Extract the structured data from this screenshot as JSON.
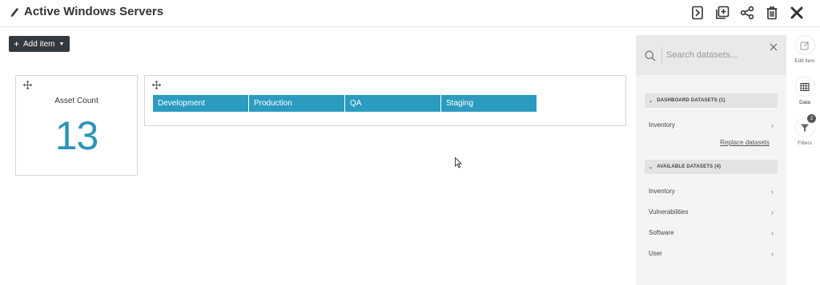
{
  "header": {
    "title": "Active Windows Servers",
    "toolbar": [
      "bookmark-icon",
      "duplicate-icon",
      "share-icon",
      "trash-icon",
      "close-icon"
    ]
  },
  "add_item": {
    "label": "Add item"
  },
  "widgets": {
    "asset_count": {
      "label": "Asset Count",
      "value": "13"
    },
    "tabs": [
      "Development",
      "Production",
      "QA",
      "Staging"
    ]
  },
  "panel": {
    "search_placeholder": "Search datasets...",
    "dashboard_header": "DASHBOARD DATASETS (1)",
    "dashboard_items": [
      "Inventory"
    ],
    "replace_label": "Replace datasets",
    "available_header": "AVAILABLE DATASETS (4)",
    "available_items": [
      "Inventory",
      "Vulnerabilities",
      "Software",
      "User"
    ]
  },
  "rail": {
    "edit_label": "Edit item",
    "data_label": "Data",
    "filters_label": "Filters",
    "filters_badge": "2"
  },
  "colors": {
    "accent": "#2b9cbf",
    "value_color": "#2b95b8",
    "button_dark": "#33393f"
  }
}
